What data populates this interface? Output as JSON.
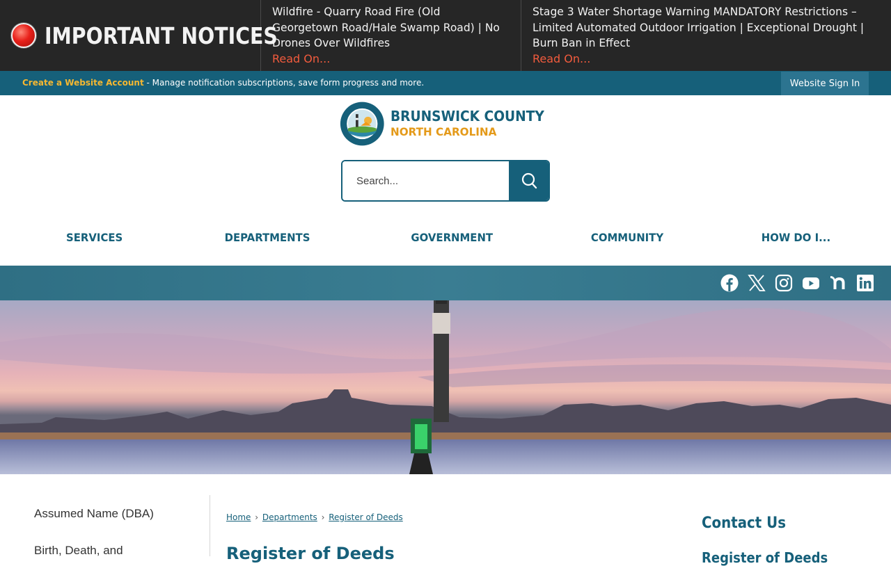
{
  "alerts": {
    "heading": "IMPORTANT NOTICES",
    "items": [
      {
        "text": "Wildfire - Quarry Road Fire (Old Georgetown Road/Hale Swamp Road) | No Drones Over Wildfires",
        "link": "Read On..."
      },
      {
        "text": "Stage 3 Water Shortage Warning MANDATORY Restrictions – Limited Automated Outdoor Irrigation | Exceptional Drought | Burn Ban in Effect",
        "link": "Read On..."
      }
    ]
  },
  "account_bar": {
    "create_link": "Create a Website Account",
    "description": " - Manage notification subscriptions, save form progress and more.",
    "sign_in": "Website Sign In"
  },
  "logo": {
    "line1": "BRUNSWICK COUNTY",
    "line2": "NORTH CAROLINA",
    "seal_top": "BRUNSWICK COUNTY",
    "seal_bottom": "NORTH CAROLINA"
  },
  "search": {
    "placeholder": "Search..."
  },
  "nav": {
    "items": [
      "SERVICES",
      "DEPARTMENTS",
      "GOVERNMENT",
      "COMMUNITY",
      "HOW DO I..."
    ]
  },
  "social": {
    "icons": [
      "facebook-icon",
      "x-icon",
      "instagram-icon",
      "youtube-icon",
      "nextdoor-icon",
      "linkedin-icon"
    ]
  },
  "sidebar": {
    "items": [
      "Assumed Name (DBA)",
      "Birth, Death, and"
    ]
  },
  "breadcrumb": {
    "items": [
      "Home",
      "Departments",
      "Register of Deeds"
    ],
    "separator": "›"
  },
  "page": {
    "title": "Register of Deeds"
  },
  "contact": {
    "title": "Contact Us",
    "subtitle": "Register of Deeds"
  },
  "colors": {
    "brand_teal": "#16607a",
    "brand_orange": "#e49a1a",
    "alert_link": "#f25b3d",
    "account_link": "#f5b731",
    "alerts_bg": "#262626"
  }
}
